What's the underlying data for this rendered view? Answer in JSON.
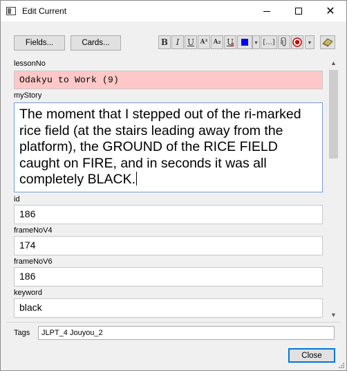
{
  "window": {
    "title": "Edit Current"
  },
  "toolbar": {
    "fields_label": "Fields...",
    "cards_label": "Cards...",
    "bold": "B",
    "italic": "I",
    "underline": "U",
    "superscript": "A²",
    "subscript": "A₂",
    "clear_format": "U",
    "text_color": "#0000ff",
    "cloze": "[...]",
    "attach": "📎",
    "record": "●",
    "menu": "▾"
  },
  "fields": [
    {
      "label": "lessonNo",
      "value": "Odakyu to Work (9)"
    },
    {
      "label": "myStory",
      "value": "The moment that I stepped out of the ri-marked rice field (at the stairs leading away from the platform), the GROUND of the RICE FIELD caught on FIRE, and in seconds it was all completely BLACK."
    },
    {
      "label": "id",
      "value": "186"
    },
    {
      "label": "frameNoV4",
      "value": "174"
    },
    {
      "label": "frameNoV6",
      "value": "186"
    },
    {
      "label": "keyword",
      "value": "black"
    }
  ],
  "tags": {
    "label": "Tags",
    "value": "JLPT_4 Jouyou_2"
  },
  "footer": {
    "close_label": "Close"
  },
  "colors": {
    "lesson_bg": "#ffc8c8",
    "focus_border": "#7a9ad6",
    "default_button_border": "#0078d7"
  }
}
